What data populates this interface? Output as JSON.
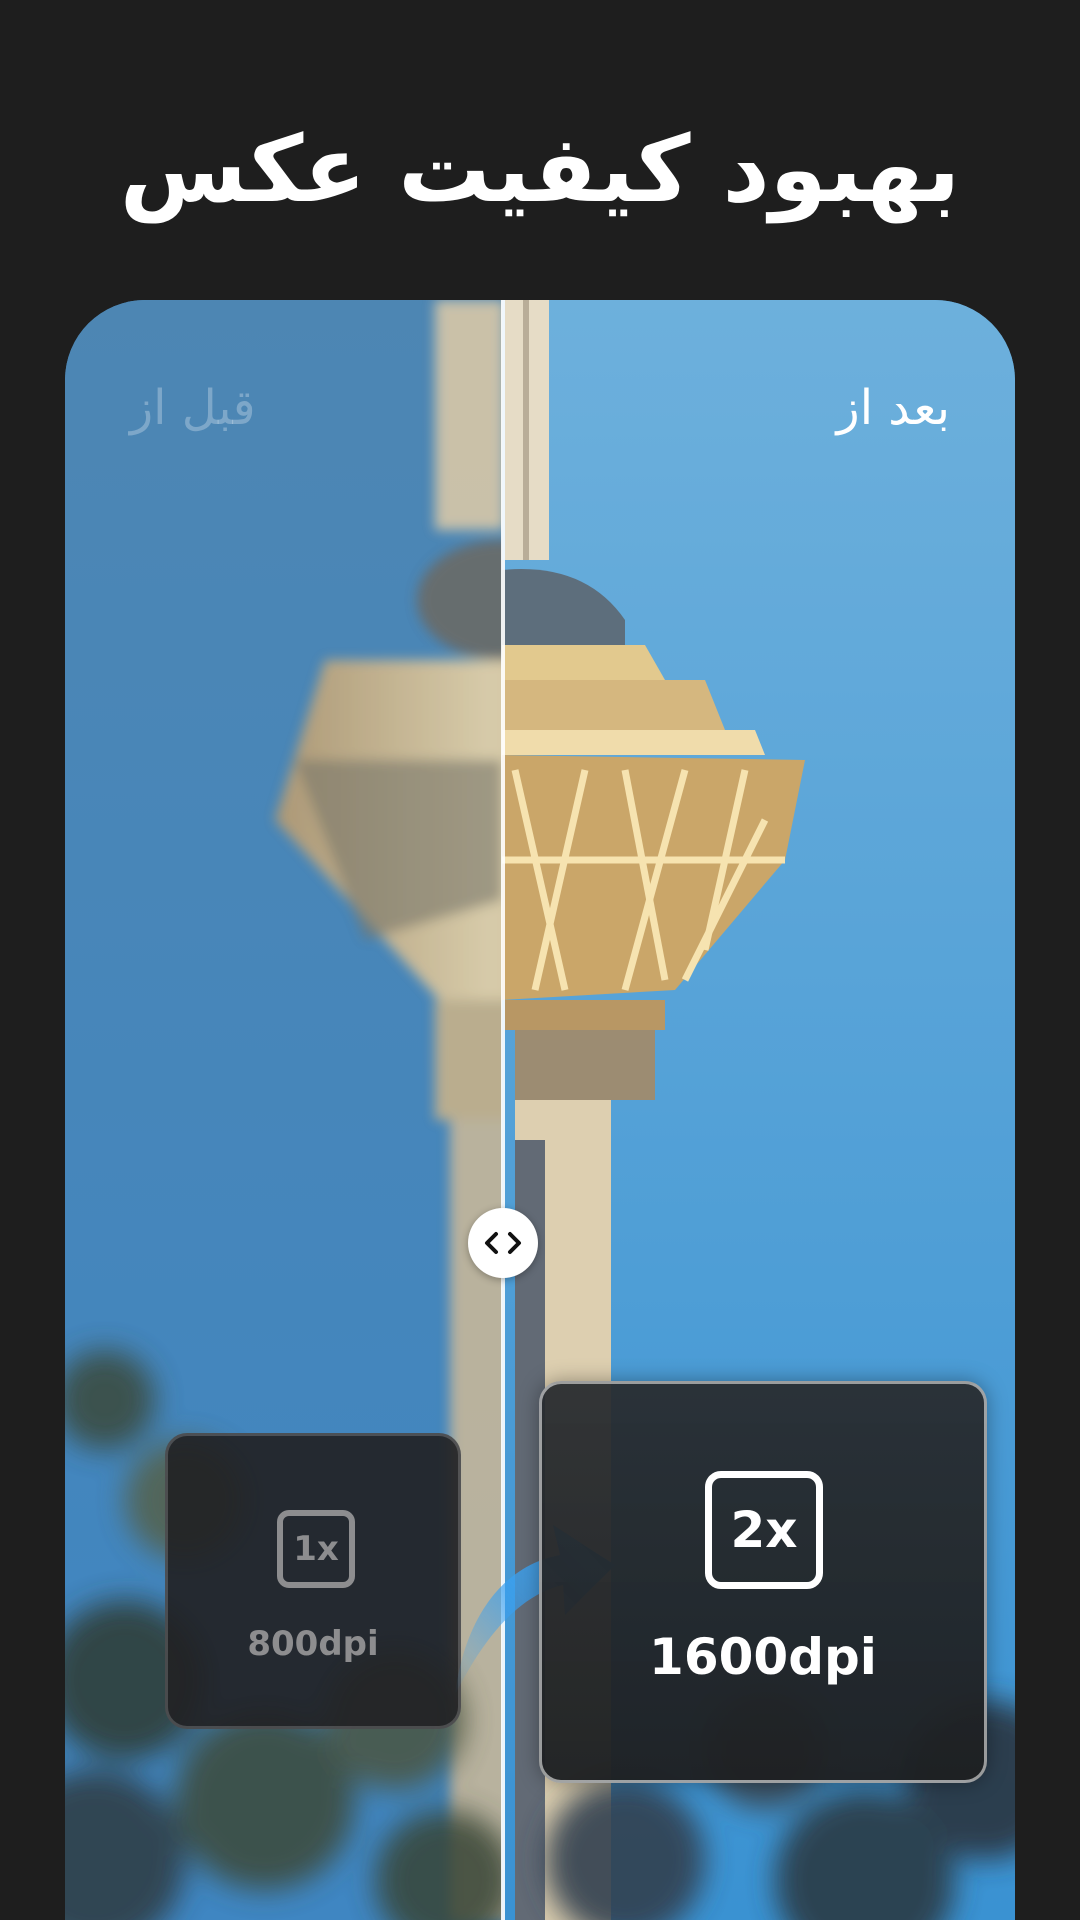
{
  "header": {
    "title": "بهبود کیفیت عکس"
  },
  "comparison": {
    "before_label": "قبل از",
    "after_label": "بعد از",
    "handle_icon": "left-right-arrows-icon",
    "before_badge": {
      "scale": "1x",
      "resolution": "800dpi"
    },
    "after_badge": {
      "scale": "2x",
      "resolution": "1600dpi"
    },
    "arrow_icon": "curved-arrow-icon"
  },
  "colors": {
    "background": "#1e1e1e",
    "sky": "#4a90c8",
    "accent_arrow": "#3aa0f0"
  }
}
